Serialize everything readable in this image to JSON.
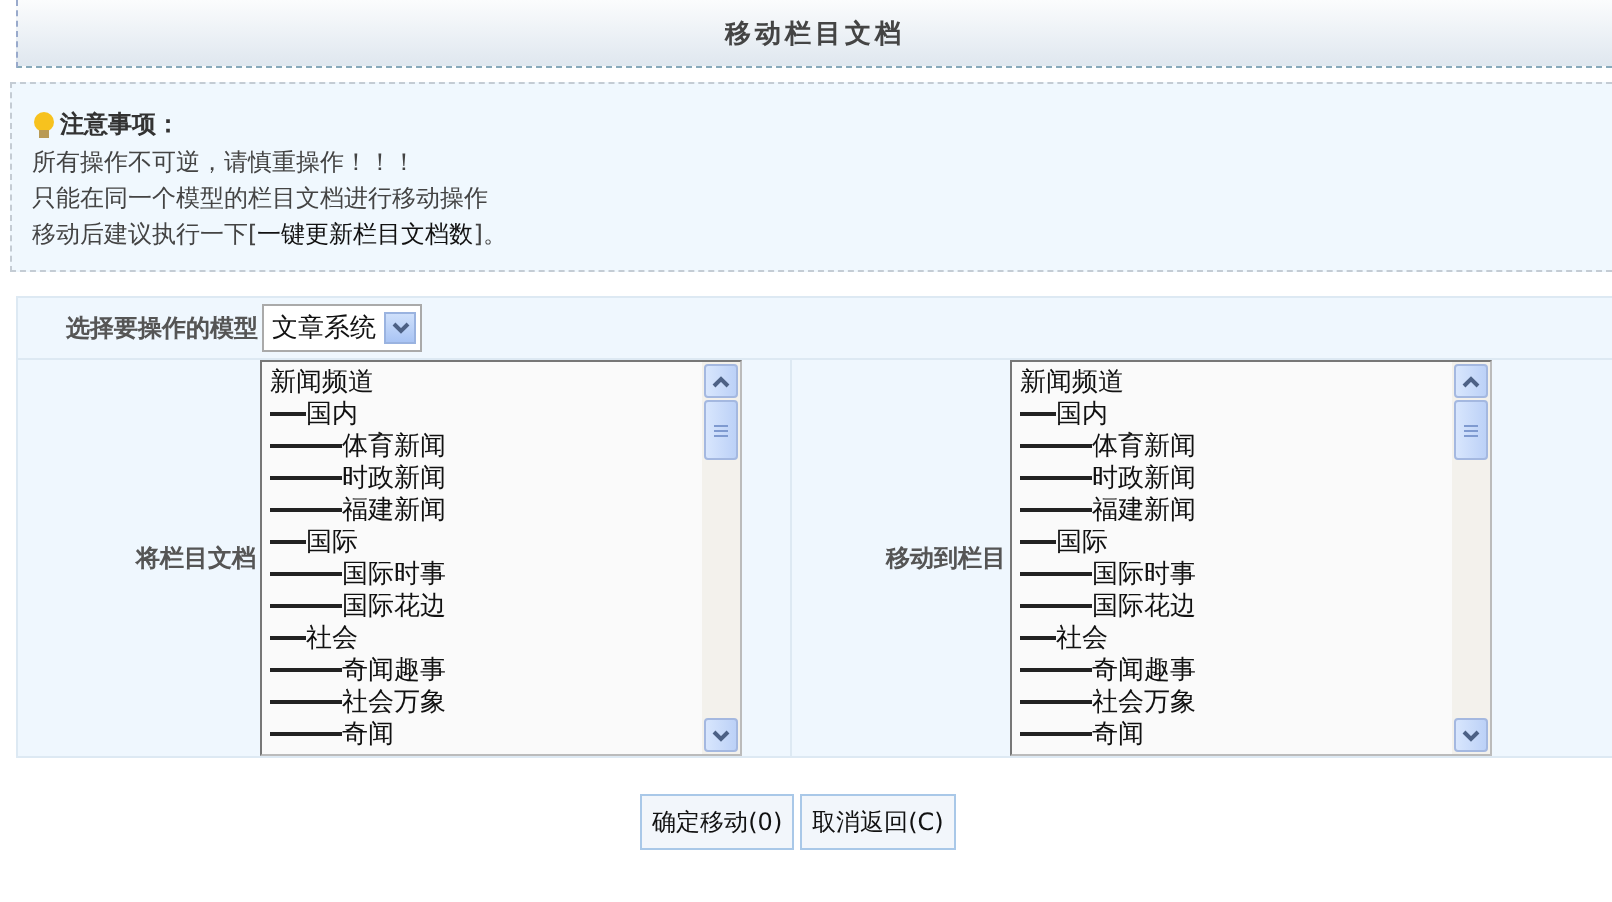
{
  "title": "移动栏目文档",
  "notice": {
    "heading": "注意事项：",
    "lines": [
      "所有操作不可逆，请慎重操作！！！",
      "只能在同一个模型的栏目文档进行移动操作"
    ],
    "link_line": {
      "before": "移动后建议执行一下[",
      "link": "一键更新栏目文档数",
      "after": "]。"
    }
  },
  "model": {
    "label": "选择要操作的模型",
    "value": "文章系统"
  },
  "lists": [
    {
      "label": "将栏目文档",
      "items": [
        {
          "name": "新闻频道",
          "children": [
            {
              "name": "国内",
              "children": [
                {
                  "name": "体育新闻"
                },
                {
                  "name": "时政新闻"
                },
                {
                  "name": "福建新闻"
                }
              ]
            },
            {
              "name": "国际",
              "children": [
                {
                  "name": "国际时事"
                },
                {
                  "name": "国际花边"
                }
              ]
            },
            {
              "name": "社会",
              "children": [
                {
                  "name": "奇闻趣事"
                },
                {
                  "name": "社会万象"
                },
                {
                  "name": "奇闻"
                }
              ]
            }
          ]
        }
      ]
    },
    {
      "label": "移动到栏目",
      "items": [
        {
          "name": "新闻频道",
          "children": [
            {
              "name": "国内",
              "children": [
                {
                  "name": "体育新闻"
                },
                {
                  "name": "时政新闻"
                },
                {
                  "name": "福建新闻"
                }
              ]
            },
            {
              "name": "国际",
              "children": [
                {
                  "name": "国际时事"
                },
                {
                  "name": "国际花边"
                }
              ]
            },
            {
              "name": "社会",
              "children": [
                {
                  "name": "奇闻趣事"
                },
                {
                  "name": "社会万象"
                },
                {
                  "name": "奇闻"
                }
              ]
            }
          ]
        }
      ]
    }
  ],
  "buttons": [
    "确定移动(0)",
    "取消返回(C)"
  ]
}
